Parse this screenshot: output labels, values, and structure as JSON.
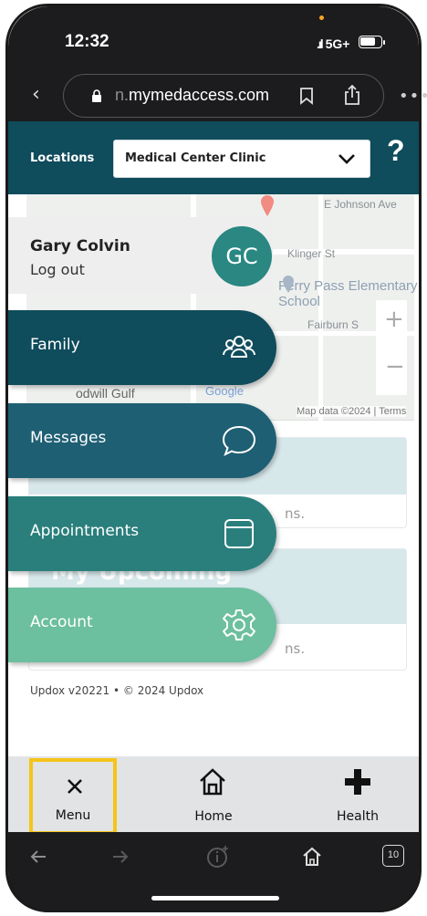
{
  "status": {
    "time": "12:32",
    "network": "5G+"
  },
  "browser": {
    "url_faded": "n.",
    "url_main": "mymedaccess.com",
    "icons": [
      "back-chevron-icon",
      "lock-icon",
      "bookmark-icon",
      "share-icon",
      "more-icon"
    ]
  },
  "locations": {
    "label": "Locations",
    "selected": "Medical Center Clinic",
    "help": "?"
  },
  "map": {
    "labels": [
      "E Johnson Ave",
      "Klinger St",
      "Fairburn S",
      "odwill Gulf"
    ],
    "school": "Ferry Pass Elementary School",
    "google": "Google",
    "credit": "Map data ©2024",
    "terms": "Terms",
    "zoom_in": "+",
    "zoom_out": "−"
  },
  "cards": {
    "snippet1": "ns.",
    "upcoming_title": "My Upcoming",
    "snippet2": "ns."
  },
  "footer": "Updox v20221 • © 2024 Updox",
  "user": {
    "name": "Gary Colvin",
    "logout": "Log out",
    "initials": "GC"
  },
  "menu": [
    {
      "label": "Family",
      "icon": "family-icon",
      "color": "#0f4c5c"
    },
    {
      "label": "Messages",
      "icon": "message-bubble-icon",
      "color": "#1e5f74"
    },
    {
      "label": "Appointments",
      "icon": "calendar-icon",
      "color": "#2a7f7c"
    },
    {
      "label": "Account",
      "icon": "gear-icon",
      "color": "#6cbf9f"
    }
  ],
  "bottom_nav": {
    "menu": "Menu",
    "home": "Home",
    "health": "Health"
  },
  "safari_toolbar": {
    "tabs_count": "10"
  },
  "colors": {
    "brand_dark": "#0f4c5c",
    "highlight": "#f5c518",
    "nav_bg": "#e2e3e5"
  }
}
